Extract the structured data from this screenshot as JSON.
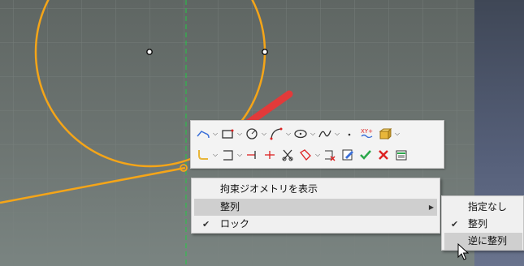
{
  "context_menu": {
    "items": [
      {
        "label": "拘束ジオメトリを表示",
        "checked": false,
        "has_submenu": false
      },
      {
        "label": "整列",
        "checked": false,
        "has_submenu": true,
        "highlighted": true
      },
      {
        "label": "ロック",
        "checked": true,
        "has_submenu": false
      }
    ]
  },
  "submenu": {
    "items": [
      {
        "label": "指定なし",
        "checked": false
      },
      {
        "label": "整列",
        "checked": true
      },
      {
        "label": "逆に整列",
        "checked": false,
        "highlighted": true
      }
    ]
  },
  "toolbar": {
    "row1_icons": [
      "polyline-icon",
      "rectangle-icon",
      "circle-icon",
      "arc-icon",
      "ellipse-icon",
      "bspline-icon",
      "point-icon",
      "external-geometry-icon",
      "construction-mode-icon"
    ],
    "row2_icons": [
      "fillet-icon",
      "slot-icon",
      "trim-icon",
      "extend-icon",
      "split-icon",
      "symmetry-icon",
      "clone-icon",
      "delete-icon",
      "edit-icon",
      "ok-icon",
      "cancel-icon",
      "sketcher-settings-icon"
    ],
    "xy_label": "XY+"
  },
  "colors": {
    "accent": "#f5a518",
    "arrow": "#e23a3a",
    "axis": "#22cc44"
  }
}
